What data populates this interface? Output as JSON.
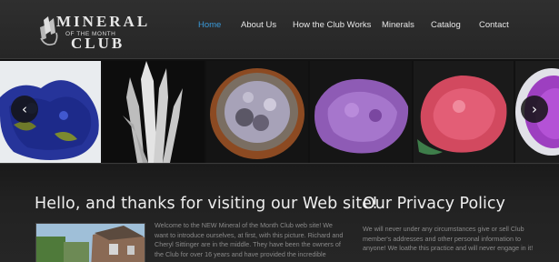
{
  "logo": {
    "word_top": "MINERAL",
    "word_sub": "OF THE MONTH",
    "word_bottom": "CLUB"
  },
  "nav": {
    "items": [
      {
        "label": "Home",
        "active": true
      },
      {
        "label": "About Us",
        "active": false
      },
      {
        "label": "How the Club Works",
        "active": false
      },
      {
        "label": "Minerals",
        "active": false
      },
      {
        "label": "Catalog",
        "active": false
      },
      {
        "label": "Contact",
        "active": false
      }
    ],
    "active_color": "#3a9ad9"
  },
  "slider": {
    "prev_icon": "chevron-left-icon",
    "next_icon": "chevron-right-icon",
    "prev_glyph": "‹",
    "next_glyph": "›"
  },
  "welcome": {
    "heading": "Hello, and thanks for visiting our Web site!",
    "body": "Welcome to the NEW Mineral of the Month Club web site! We want to introduce ourselves, at first, with this picture. Richard and Cheryl Sittinger are in the middle. They have been the owners of the Club for over 16 years and have provided the incredible"
  },
  "privacy": {
    "heading": "Our Privacy Policy",
    "body": "We will never under any circumstances give or sell Club member's addresses and other personal information to anyone! We loathe this practice and will never engage in it!"
  }
}
